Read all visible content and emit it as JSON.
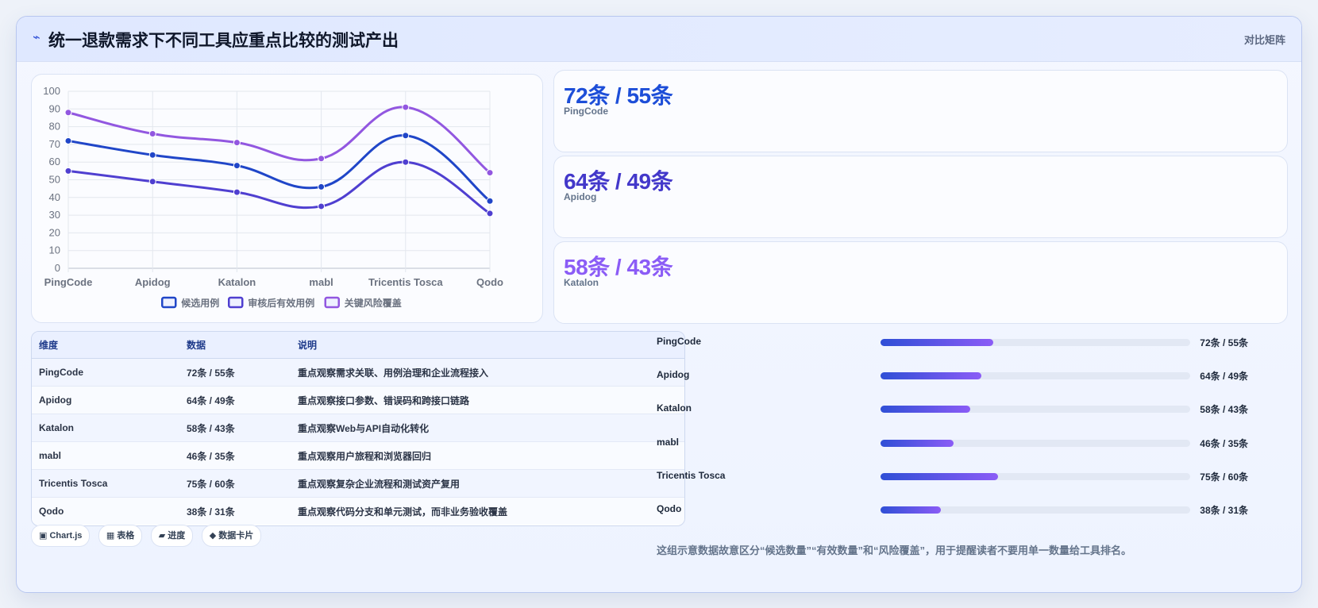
{
  "header": {
    "title": "统一退款需求下不同工具应重点比较的测试产出",
    "tag": "对比矩阵",
    "icon": "bolt-icon"
  },
  "chart_data": {
    "type": "line",
    "title": "",
    "xlabel": "",
    "ylabel": "",
    "ylim": [
      0,
      100
    ],
    "yticks": [
      0,
      10,
      20,
      30,
      40,
      50,
      60,
      70,
      80,
      90,
      100
    ],
    "categories": [
      "PingCode",
      "Apidog",
      "Katalon",
      "mabl",
      "Tricentis Tosca",
      "Qodo"
    ],
    "series": [
      {
        "name": "候选用例",
        "values": [
          72,
          64,
          58,
          46,
          75,
          38
        ],
        "color": "#2046c8"
      },
      {
        "name": "审核后有效用例",
        "values": [
          55,
          49,
          43,
          35,
          60,
          31
        ],
        "color": "#4f3fd0"
      },
      {
        "name": "关键风险覆盖",
        "values": [
          88,
          76,
          71,
          62,
          91,
          54
        ],
        "color": "#9257e0"
      }
    ],
    "grid": true,
    "legend": "bottom"
  },
  "stats": [
    {
      "value": "72条 / 55条",
      "label": "PingCode",
      "color": "#1d4ed8"
    },
    {
      "value": "64条 / 49条",
      "label": "Apidog",
      "color": "#4338ca"
    },
    {
      "value": "58条 / 43条",
      "label": "Katalon",
      "color": "#8b5cf6"
    }
  ],
  "table": {
    "headers": [
      "维度",
      "数据",
      "说明"
    ],
    "rows": [
      [
        "PingCode",
        "72条 / 55条",
        "重点观察需求关联、用例治理和企业流程接入"
      ],
      [
        "Apidog",
        "64条 / 49条",
        "重点观察接口参数、错误码和跨接口链路"
      ],
      [
        "Katalon",
        "58条 / 43条",
        "重点观察Web与API自动化转化"
      ],
      [
        "mabl",
        "46条 / 35条",
        "重点观察用户旅程和浏览器回归"
      ],
      [
        "Tricentis Tosca",
        "75条 / 60条",
        "重点观察复杂企业流程和测试资产复用"
      ],
      [
        "Qodo",
        "38条 / 31条",
        "重点观察代码分支和单元测试，而非业务验收覆盖"
      ]
    ]
  },
  "progress": [
    {
      "name": "PingCode",
      "value": "72条 / 55条",
      "fraction": 0.365
    },
    {
      "name": "Apidog",
      "value": "64条 / 49条",
      "fraction": 0.325
    },
    {
      "name": "Katalon",
      "value": "58条 / 43条",
      "fraction": 0.29
    },
    {
      "name": "mabl",
      "value": "46条 / 35条",
      "fraction": 0.235
    },
    {
      "name": "Tricentis Tosca",
      "value": "75条 / 60条",
      "fraction": 0.38
    },
    {
      "name": "Qodo",
      "value": "38条 / 31条",
      "fraction": 0.195
    }
  ],
  "chips": [
    "▣ Chart.js",
    "▦ 表格",
    "▰ 进度",
    "◆ 数据卡片"
  ],
  "note": "这组示意数据故意区分“候选数量”“有效数量”和“风险覆盖”，用于提醒读者不要用单一数量给工具排名。"
}
